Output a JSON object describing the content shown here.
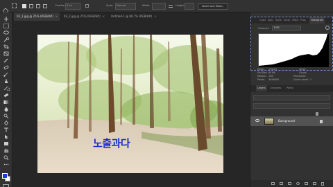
{
  "options": {
    "feather_label": "Feather:",
    "feather_value": "0 px",
    "style_label": "Style:",
    "style_value": "Normal",
    "width_label": "Width:",
    "height_label": "Height:",
    "select_mask_label": "Select and Mask..."
  },
  "tabs": [
    {
      "label": "02_1.jpg @ 25% (RGB/8#)",
      "active": true
    },
    {
      "label": "02_2.jpg @ 25% (RGB/8#)",
      "active": false
    },
    {
      "label": "Untitled-1 @ 66.7% (RGB/8#)",
      "active": false
    }
  ],
  "canvas": {
    "overlay_text": "노출과다"
  },
  "histogram_panel": {
    "tabs": [
      "Color",
      "Adju",
      "Style",
      "Actio",
      "Histo",
      "Prop",
      "Histogram"
    ],
    "channel_label": "Channel:",
    "channel_value": "RGB",
    "stats": {
      "mean_label": "Mean:",
      "mean": "178.29",
      "std_label": "Std Dev:",
      "std": "63.66",
      "median_label": "Median:",
      "median": "198",
      "pixels_label": "Pixels:",
      "pixels": "3459000",
      "level_label": "Level:",
      "count_label": "Count:",
      "percentile_label": "Percentile:",
      "cache_label": "Cache Level:",
      "cache": "1"
    }
  },
  "layers_panel": {
    "tabs": [
      "Layers",
      "Channels",
      "Paths"
    ],
    "layer_name": "Background"
  },
  "colors": {
    "overlay_text": "#1a2dcf",
    "histogram_highlight": "#7a8ed6",
    "foreground": "#1a3dd6",
    "background": "#ffffff"
  }
}
